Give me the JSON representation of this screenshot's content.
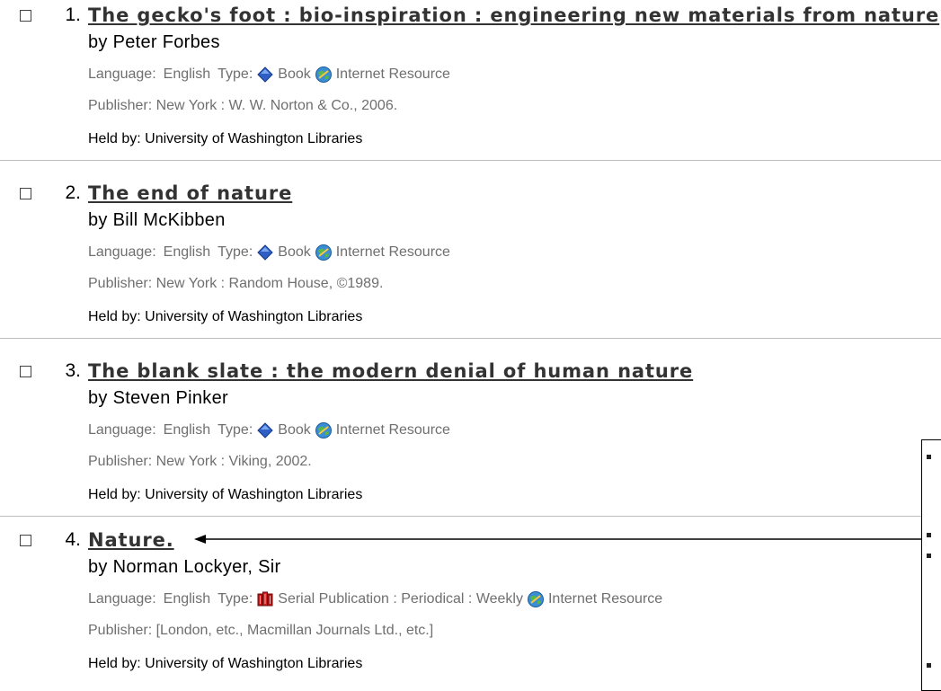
{
  "results": [
    {
      "number": "1.",
      "title": "The gecko's foot : bio-inspiration : engineering new materials from nature",
      "author": "by Peter Forbes",
      "language_label": "Language:",
      "language": "English",
      "type_label": "Type:",
      "types": [
        {
          "icon": "book-icon",
          "label": "Book"
        },
        {
          "icon": "internet-resource-icon",
          "label": "Internet Resource"
        }
      ],
      "publisher": "Publisher: New York : W. W. Norton & Co., 2006.",
      "held_by": "Held by: University of Washington Libraries"
    },
    {
      "number": "2.",
      "title": "The end of nature",
      "author": "by Bill McKibben",
      "language_label": "Language:",
      "language": "English",
      "type_label": "Type:",
      "types": [
        {
          "icon": "book-icon",
          "label": "Book"
        },
        {
          "icon": "internet-resource-icon",
          "label": "Internet Resource"
        }
      ],
      "publisher": "Publisher: New York : Random House, ©1989.",
      "held_by": "Held by: University of Washington Libraries"
    },
    {
      "number": "3.",
      "title": "The blank slate : the modern denial of human nature",
      "author": "by Steven Pinker",
      "language_label": "Language:",
      "language": "English",
      "type_label": "Type:",
      "types": [
        {
          "icon": "book-icon",
          "label": "Book"
        },
        {
          "icon": "internet-resource-icon",
          "label": "Internet Resource"
        }
      ],
      "publisher": "Publisher: New York : Viking, 2002.",
      "held_by": "Held by: University of Washington Libraries"
    },
    {
      "number": "4.",
      "title": "Nature.",
      "author": "by Norman Lockyer, Sir",
      "language_label": "Language:",
      "language": "English",
      "type_label": "Type:",
      "types": [
        {
          "icon": "serial-publication-icon",
          "label": "Serial Publication : Periodical : Weekly"
        },
        {
          "icon": "internet-resource-icon",
          "label": "Internet Resource"
        }
      ],
      "publisher": "Publisher: [London, etc., Macmillan Journals Ltd., etc.]",
      "held_by": "Held by: University of Washington Libraries"
    }
  ],
  "colors": {
    "title": "#333333",
    "meta": "#6f6f6f",
    "book_icon": "#2f5fc4",
    "serial_icon": "#c01818",
    "globe_icon": "#3b8ed6"
  }
}
